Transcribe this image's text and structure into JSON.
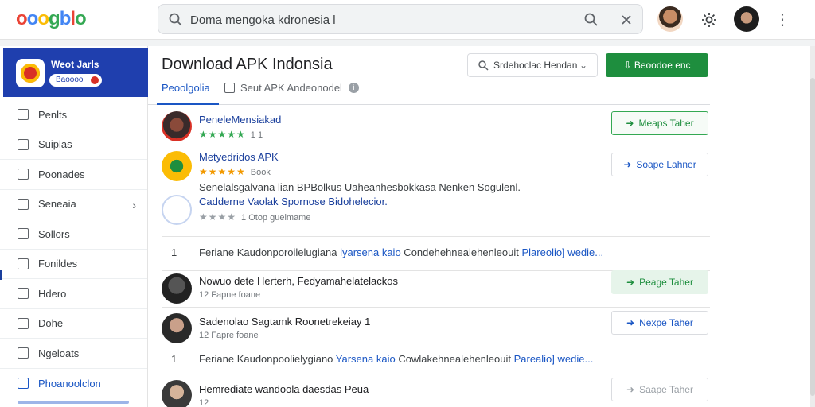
{
  "header": {
    "logo_text": "ooogblo",
    "search_value": "Doma mengoka kdronesia l",
    "avatar_icon": "user-avatar",
    "settings_icon": "gear-icon",
    "more_icon": "⋮"
  },
  "sidebar": {
    "hero_title": "Weot Jarls",
    "hero_pill": "Baoooo",
    "items": [
      {
        "label": "Penlts",
        "chevron": ""
      },
      {
        "label": "Suiplas",
        "chevron": ""
      },
      {
        "label": "Poonades",
        "chevron": ""
      },
      {
        "label": "Seneaia",
        "chevron": "›"
      },
      {
        "label": "Sollors",
        "chevron": ""
      },
      {
        "label": "Fonildes",
        "chevron": ""
      },
      {
        "label": "Hdero",
        "chevron": ""
      },
      {
        "label": "Dohe",
        "chevron": ""
      },
      {
        "label": "Ngeloats",
        "chevron": ""
      },
      {
        "label": "Phoanoolclon",
        "chevron": ""
      }
    ]
  },
  "main": {
    "title": "Download APK Indonsia",
    "filter_label": "Srdehoclac Hendan",
    "primary_button": "Beoodoe enc",
    "tab_active": "Peoolgolia",
    "tab_check_label": "Seut APK Andeonodel",
    "rows": [
      {
        "name": "PeneleMensiakad",
        "stars": "★★★★★",
        "rating": "1 1",
        "action": "Meaps Taher"
      },
      {
        "name": "Metyedridos APK",
        "stars": "★★★★★",
        "rating": "Book",
        "action": "Soape Lahner"
      }
    ],
    "desc_line": "Senelalsgalvana lian BPBolkus Uaheanhesbokkasa Nenken Sogulenl.",
    "row3": {
      "name": "Cadderne Vaolak Spornose Bidohelecior.",
      "stars": "★★★★",
      "rating": "1  Otop guelmame"
    },
    "section1": {
      "num": "1",
      "text": "Feriane Kaudonporoilelugiana ",
      "link": "lyarsena kaio",
      "text2": " Condehehnealehenleouit ",
      "link2": "Plareolio] wedie..."
    },
    "people": [
      {
        "name": "Nowuo dete Herterh, Fedyamahelatelackos",
        "meta": "12  Fapne foane",
        "action": "Peage Taher"
      },
      {
        "name": "Sadenolao Sagtamk Roonetrekeiay 1",
        "meta": "12  Fapre foane",
        "action": "Nexpe Taher"
      }
    ],
    "section2": {
      "num": "1",
      "text": "Feriane Kaudonpoolielygiano ",
      "link": "Yarsena kaio",
      "text2": " Cowlakehnealehenleouit ",
      "link2": "Parealio] wedie..."
    },
    "last": {
      "name": "Hemrediate wandoola daesdas Peua",
      "meta": "12  ",
      "action": "Saape Taher"
    }
  }
}
